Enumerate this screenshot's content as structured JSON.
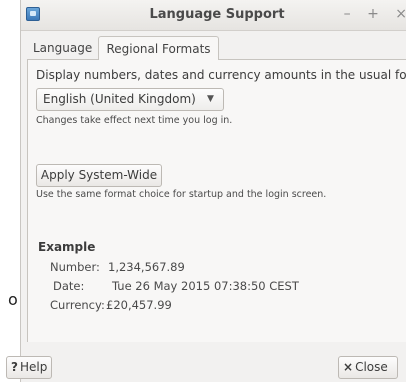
{
  "window": {
    "title": "Language Support",
    "controls": "– + ×"
  },
  "tabs": [
    {
      "label": "Language",
      "active": false
    },
    {
      "label": "Regional Formats",
      "active": true
    }
  ],
  "regional": {
    "prompt": "Display numbers, dates and currency amounts in the usual format for:",
    "locale_selected": "English (United Kingdom)",
    "locale_note": "Changes take effect next time you log in.",
    "apply_button": "Apply System-Wide",
    "apply_note": "Use the same format choice for startup and the login screen."
  },
  "example": {
    "title": "Example",
    "rows": [
      {
        "key": "Number:",
        "value": "1,234,567.89"
      },
      {
        "key": "Date:",
        "value": "Tue 26 May 2015 07:38:50 CEST"
      },
      {
        "key": "Currency:",
        "value": "£20,457.99"
      }
    ]
  },
  "footer": {
    "help_label": "Help",
    "help_icon": "?",
    "close_label": "Close",
    "close_icon": "×"
  },
  "background_fragment": "o",
  "colors": {
    "window_bg": "#f2f1f0",
    "panel_bg": "#f8f7f6",
    "titlebar_text": "#4a4a4a"
  }
}
